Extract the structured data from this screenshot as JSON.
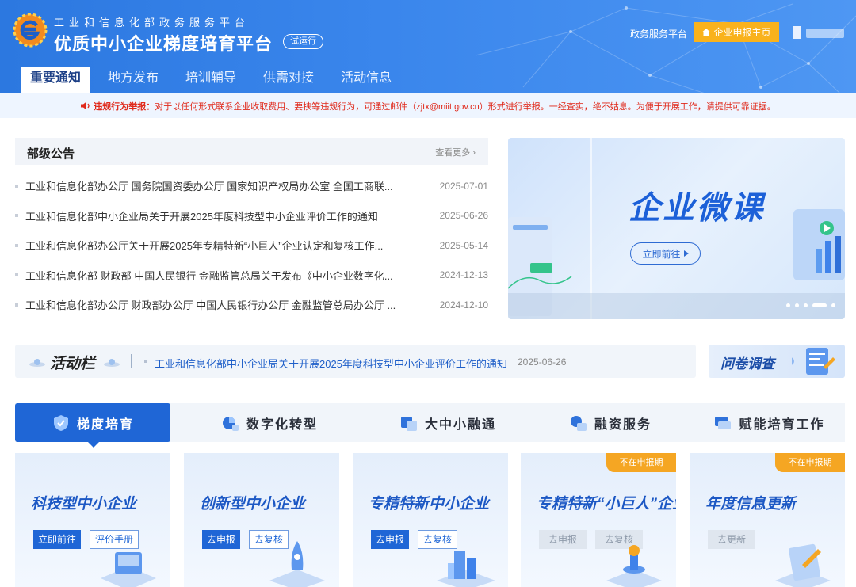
{
  "header": {
    "subtitle": "工业和信息化部政务服务平台",
    "title": "优质中小企业梯度培育平台",
    "trial_badge": "试运行",
    "gov_link": "政务服务平台",
    "enterprise_btn": "企业申报主页",
    "colors": {
      "primary": "#2c78e0",
      "accent": "#f9b21c"
    }
  },
  "nav": {
    "items": [
      {
        "label": "重要通知",
        "active": true
      },
      {
        "label": "地方发布"
      },
      {
        "label": "培训辅导"
      },
      {
        "label": "供需对接"
      },
      {
        "label": "活动信息"
      }
    ]
  },
  "notice": {
    "strong": "违规行为举报：",
    "text": "对于以任何形式联系企业收取费用、要挟等违规行为，可通过邮件（zjtx@miit.gov.cn）形式进行举报。一经查实，绝不姑息。为便于开展工作，请提供可靠证据。",
    "color": "#e0291b"
  },
  "announcements": {
    "title": "部级公告",
    "more": "查看更多",
    "items": [
      {
        "text": "工业和信息化部办公厅 国务院国资委办公厅 国家知识产权局办公室 全国工商联...",
        "date": "2025-07-01"
      },
      {
        "text": "工业和信息化部中小企业局关于开展2025年度科技型中小企业评价工作的通知",
        "date": "2025-06-26"
      },
      {
        "text": "工业和信息化部办公厅关于开展2025年专精特新“小巨人”企业认定和复核工作...",
        "date": "2025-05-14"
      },
      {
        "text": "工业和信息化部 财政部 中国人民银行 金融监管总局关于发布《中小企业数字化...",
        "date": "2024-12-13"
      },
      {
        "text": "工业和信息化部办公厅 财政部办公厅 中国人民银行办公厅 金融监管总局办公厅 ...",
        "date": "2024-12-10"
      }
    ]
  },
  "banner": {
    "title": "企业微课",
    "button": "立即前往",
    "slide_count": 5,
    "active_slide": 4
  },
  "activity": {
    "title": "活动栏",
    "link": "工业和信息化部中小企业局关于开展2025年度科技型中小企业评价工作的通知",
    "date": "2025-06-26",
    "survey": "问卷调查"
  },
  "tabs": [
    {
      "label": "梯度培育",
      "active": true,
      "icon": "shield-icon"
    },
    {
      "label": "数字化转型",
      "icon": "chart-icon"
    },
    {
      "label": "大中小融通",
      "icon": "link-icon"
    },
    {
      "label": "融资服务",
      "icon": "money-icon"
    },
    {
      "label": "赋能培育工作",
      "icon": "book-icon"
    }
  ],
  "cards": [
    {
      "title": "科技型中小企业",
      "btn1": "立即前往",
      "btn2": "评价手册"
    },
    {
      "title": "创新型中小企业",
      "btn1": "去申报",
      "btn2": "去复核"
    },
    {
      "title": "专精特新中小企业",
      "btn1": "去申报",
      "btn2": "去复核"
    },
    {
      "title": "专精特新“小巨人”企业",
      "badge": "不在申报期",
      "btn1": "去申报",
      "btn2": "去复核"
    },
    {
      "title": "年度信息更新",
      "badge": "不在申报期",
      "btn1": "去更新"
    }
  ]
}
